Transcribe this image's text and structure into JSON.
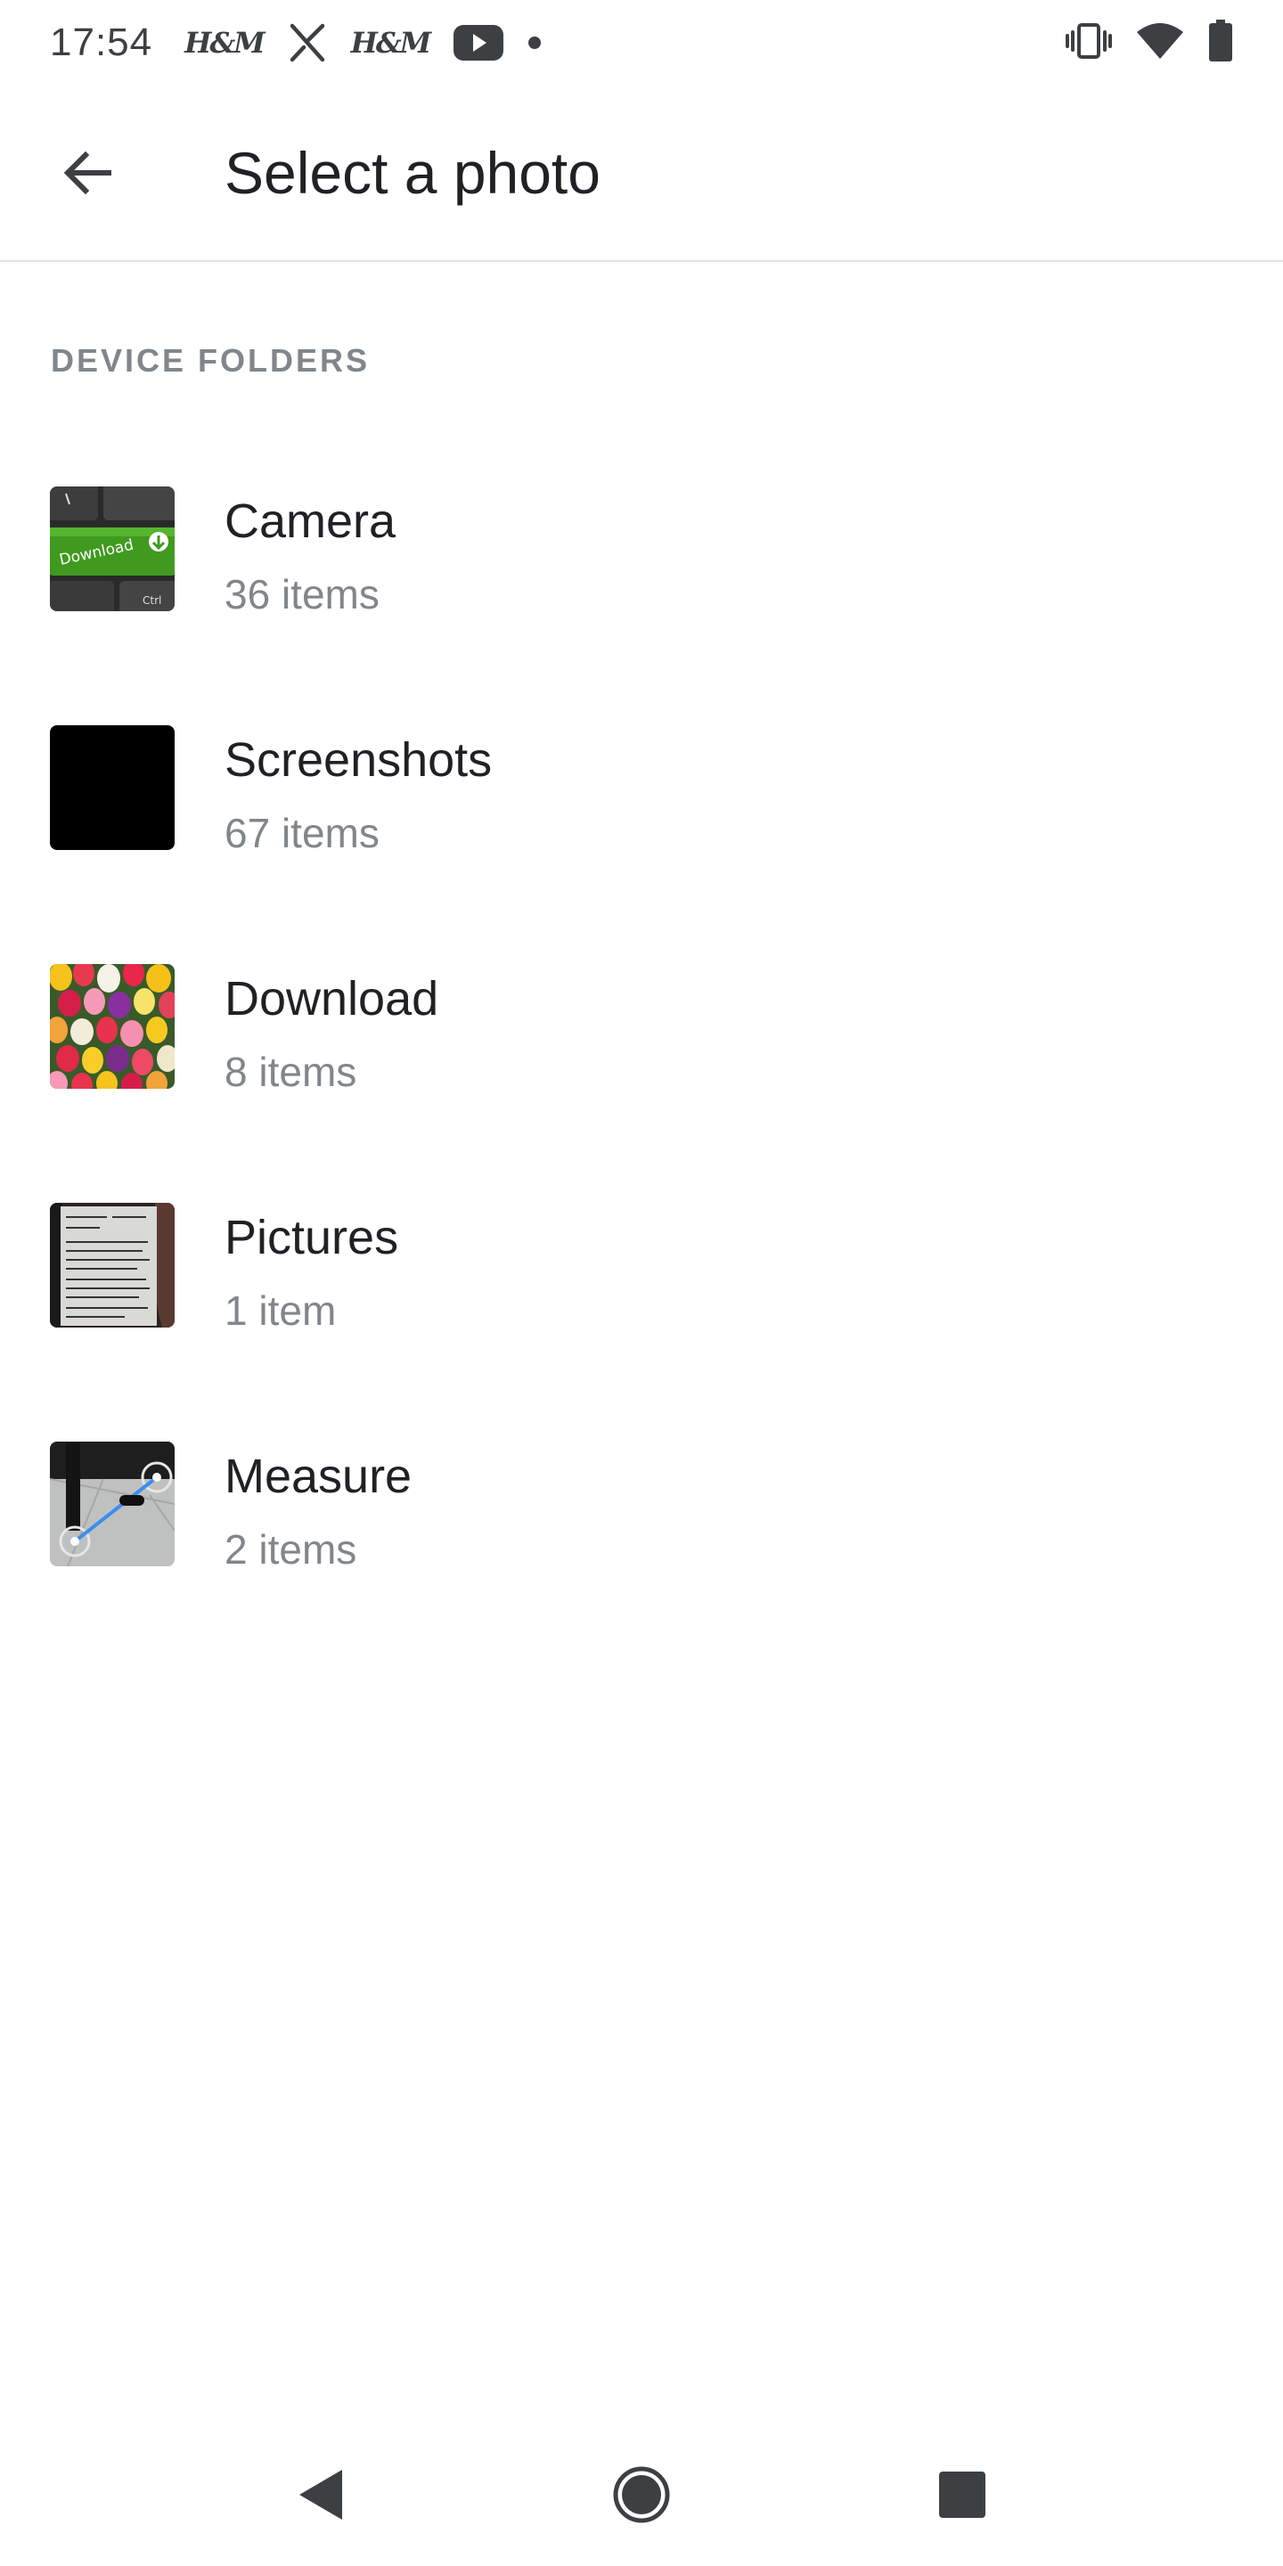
{
  "status_bar": {
    "time": "17:54",
    "notification_icons": [
      "hm-icon",
      "x-icon",
      "hm-icon",
      "youtube-icon",
      "dot-icon"
    ],
    "hm_text": "H&M",
    "system_icons": [
      "vibrate-icon",
      "wifi-icon",
      "battery-icon"
    ]
  },
  "app_bar": {
    "back_icon": "arrow-back-icon",
    "title": "Select a photo"
  },
  "section": {
    "header": "DEVICE FOLDERS"
  },
  "folders": [
    {
      "name": "Camera",
      "count": "36 items",
      "thumb": "keyboard-download-thumb"
    },
    {
      "name": "Screenshots",
      "count": "67 items",
      "thumb": "black-thumb"
    },
    {
      "name": "Download",
      "count": "8 items",
      "thumb": "tulips-thumb"
    },
    {
      "name": "Pictures",
      "count": "1 item",
      "thumb": "document-thumb"
    },
    {
      "name": "Measure",
      "count": "2 items",
      "thumb": "measure-thumb"
    }
  ],
  "thumb_text": {
    "download_key": "Download",
    "ctrl_key": "Ctrl"
  },
  "nav_bar": {
    "buttons": [
      "back-triangle-icon",
      "home-circle-icon",
      "recents-square-icon"
    ]
  },
  "colors": {
    "title": "#202124",
    "secondary": "#80868b",
    "divider": "#e3e3e3",
    "status_icons": "#3c4043"
  }
}
